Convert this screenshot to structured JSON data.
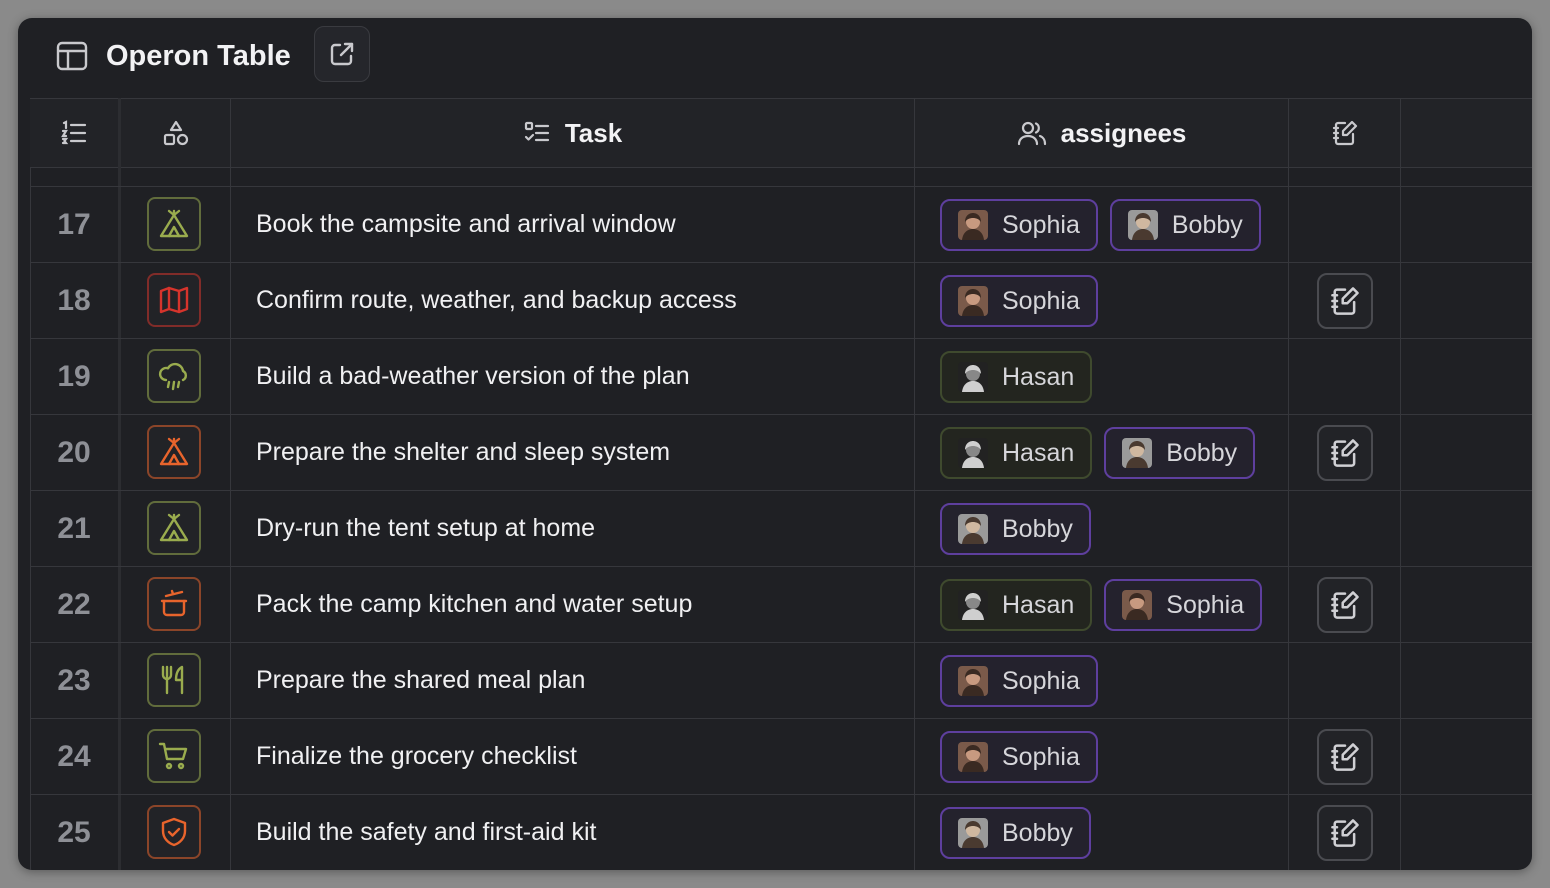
{
  "window": {
    "title": "Operon Table",
    "title_icon": "table-icon",
    "open_icon": "external-link-icon"
  },
  "columns": [
    {
      "key": "index",
      "label": "",
      "icon": "numbered-list-icon"
    },
    {
      "key": "category",
      "label": "",
      "icon": "shapes-icon"
    },
    {
      "key": "task",
      "label": "Task",
      "icon": "checklist-icon"
    },
    {
      "key": "assignees",
      "label": "assignees",
      "icon": "users-icon"
    },
    {
      "key": "notes",
      "label": "",
      "icon": "notebook-edit-icon"
    }
  ],
  "colors": {
    "green": "#8aa04a",
    "red": "#d6342c",
    "orange": "#e8642c",
    "purple_border": "#5e3f9e",
    "green_border": "#3f4a2e"
  },
  "rows": [
    {
      "num": "17",
      "icon": "tent-icon",
      "icon_color": "#9aac4e",
      "task": "Book the campsite and arrival window",
      "assignees": [
        {
          "name": "Sophia",
          "style": "purple"
        },
        {
          "name": "Bobby",
          "style": "purple"
        }
      ],
      "notes": false
    },
    {
      "num": "18",
      "icon": "map-icon",
      "icon_color": "#d6342c",
      "task": "Confirm route, weather, and backup access",
      "assignees": [
        {
          "name": "Sophia",
          "style": "purple"
        }
      ],
      "notes": true
    },
    {
      "num": "19",
      "icon": "cloud-rain-icon",
      "icon_color": "#9aac4e",
      "task": "Build a bad-weather version of the plan",
      "assignees": [
        {
          "name": "Hasan",
          "style": "green"
        }
      ],
      "notes": false
    },
    {
      "num": "20",
      "icon": "tent-icon",
      "icon_color": "#e8642c",
      "task": "Prepare the shelter and sleep system",
      "assignees": [
        {
          "name": "Hasan",
          "style": "green"
        },
        {
          "name": "Bobby",
          "style": "purple"
        }
      ],
      "notes": true
    },
    {
      "num": "21",
      "icon": "tent-icon",
      "icon_color": "#9aac4e",
      "task": "Dry-run the tent setup at home",
      "assignees": [
        {
          "name": "Bobby",
          "style": "purple"
        }
      ],
      "notes": false
    },
    {
      "num": "22",
      "icon": "cooking-pot-icon",
      "icon_color": "#e8642c",
      "task": "Pack the camp kitchen and water setup",
      "assignees": [
        {
          "name": "Hasan",
          "style": "green"
        },
        {
          "name": "Sophia",
          "style": "purple"
        }
      ],
      "notes": true
    },
    {
      "num": "23",
      "icon": "utensils-icon",
      "icon_color": "#9aac4e",
      "task": "Prepare the shared meal plan",
      "assignees": [
        {
          "name": "Sophia",
          "style": "purple"
        }
      ],
      "notes": false
    },
    {
      "num": "24",
      "icon": "shopping-cart-icon",
      "icon_color": "#9aac4e",
      "task": "Finalize the grocery checklist",
      "assignees": [
        {
          "name": "Sophia",
          "style": "purple"
        }
      ],
      "notes": true
    },
    {
      "num": "25",
      "icon": "shield-check-icon",
      "icon_color": "#e8642c",
      "task": "Build the safety and first-aid kit",
      "assignees": [
        {
          "name": "Bobby",
          "style": "purple"
        }
      ],
      "notes": true
    }
  ]
}
